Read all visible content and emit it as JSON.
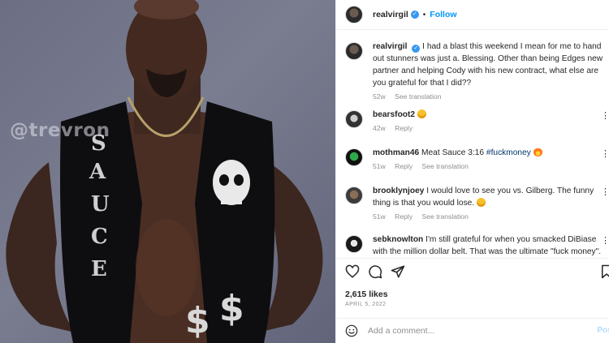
{
  "photo": {
    "watermark": "@trevron"
  },
  "header": {
    "username": "realvirgil",
    "follow_label": "Follow",
    "dot": "•"
  },
  "comments": [
    {
      "username": "realvirgil",
      "text": "I had a blast this weekend I mean for me to hand out stunners was just a. Blessing. Other than being Edges new partner and helping Cody with his new contract, what else are you grateful for that I did??",
      "time": "52w",
      "translation": "See translation",
      "verified": true
    },
    {
      "username": "bearsfoot2",
      "text": "",
      "emoji": "grinning-face",
      "time": "42w",
      "reply": "Reply"
    },
    {
      "username": "mothman46",
      "text": "Meat Sauce 3:16",
      "hashtag": "#fuckmoney",
      "emoji": "fire",
      "time": "51w",
      "reply": "Reply",
      "translation": "See translation"
    },
    {
      "username": "brooklynjoey",
      "text": "I would love to see you vs. Gilberg. The funny thing is that you would lose.",
      "emoji": "grinning-face",
      "time": "51w",
      "reply": "Reply",
      "translation": "See translation"
    },
    {
      "username": "sebknowlton",
      "text": "I'm still grateful for when you smacked DiBiase with the million dollar belt. That was the ultimate \"fuck money\"."
    }
  ],
  "likes": "2,615 likes",
  "date": "APRIL 5, 2022",
  "add_comment": {
    "placeholder": "Add a comment...",
    "post_label": "Post"
  },
  "colors": {
    "accent": "#0095f6",
    "verified": "#3897f0",
    "muted": "#8e8e8e"
  },
  "icons": [
    "heart-icon",
    "comment-icon",
    "share-icon",
    "bookmark-icon",
    "smiley-icon",
    "more-icon"
  ]
}
